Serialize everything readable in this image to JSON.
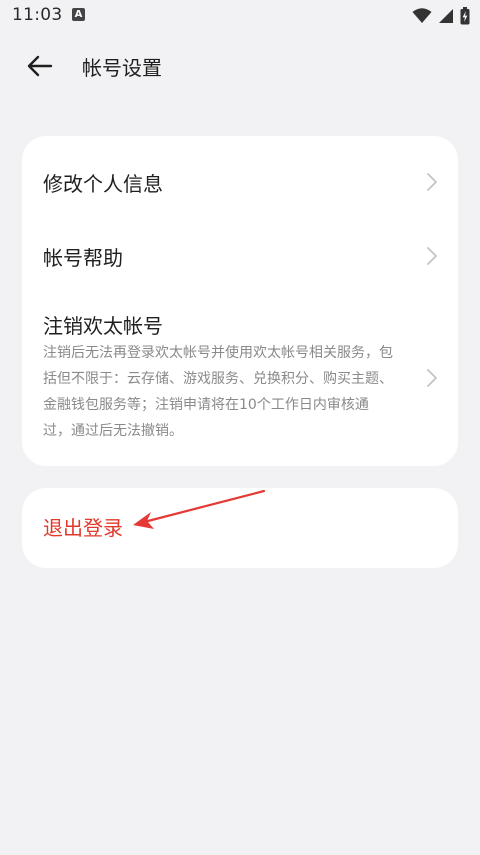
{
  "status_bar": {
    "time": "11:03",
    "notification_letter": "A",
    "icons": [
      "wifi-icon",
      "signal-icon",
      "battery-icon"
    ]
  },
  "header": {
    "back_icon": "arrow-left-icon",
    "title": "帐号设置"
  },
  "settings": {
    "items": [
      {
        "label": "修改个人信息",
        "icon": "chevron-right-icon"
      },
      {
        "label": "帐号帮助",
        "icon": "chevron-right-icon"
      },
      {
        "label": "注销欢太帐号",
        "description": "注销后无法再登录欢太帐号并使用欢太帐号相关服务，包括但不限于：云存储、游戏服务、兑换积分、购买主题、金融钱包服务等；注销申请将在10个工作日内审核通过，通过后无法撤销。",
        "icon": "chevron-right-icon"
      }
    ]
  },
  "logout": {
    "label": "退出登录"
  },
  "colors": {
    "background": "#f2f2f4",
    "card": "#ffffff",
    "danger": "#e23a2c",
    "annotation": "#e53935",
    "secondary_text": "#8a8a8a"
  }
}
